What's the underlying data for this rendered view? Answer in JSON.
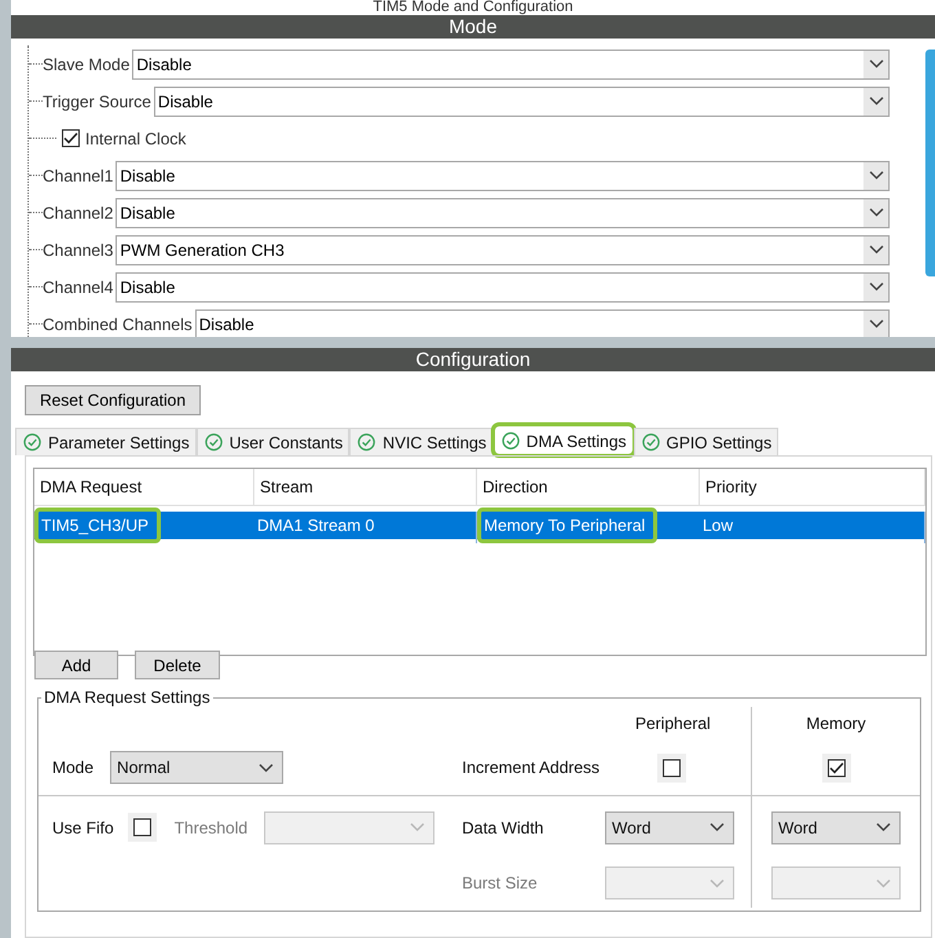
{
  "window": {
    "title": "TIM5 Mode and Configuration"
  },
  "mode": {
    "title": "Mode",
    "items": [
      {
        "kind": "select",
        "label": "Slave Mode",
        "value": "Disable"
      },
      {
        "kind": "select",
        "label": "Trigger Source",
        "value": "Disable"
      },
      {
        "kind": "checkbox",
        "label": "Internal Clock",
        "checked": true
      },
      {
        "kind": "select",
        "label": "Channel1",
        "value": "Disable"
      },
      {
        "kind": "select",
        "label": "Channel2",
        "value": "Disable"
      },
      {
        "kind": "select",
        "label": "Channel3",
        "value": "PWM Generation CH3"
      },
      {
        "kind": "select",
        "label": "Channel4",
        "value": "Disable"
      },
      {
        "kind": "select",
        "label": "Combined Channels",
        "value": "Disable"
      }
    ]
  },
  "configuration": {
    "title": "Configuration",
    "reset_button": "Reset Configuration",
    "tabs": [
      {
        "label": "Parameter Settings",
        "selected": false,
        "highlighted": false
      },
      {
        "label": "User Constants",
        "selected": false,
        "highlighted": false
      },
      {
        "label": "NVIC Settings",
        "selected": false,
        "highlighted": false
      },
      {
        "label": "DMA Settings",
        "selected": true,
        "highlighted": true
      },
      {
        "label": "GPIO Settings",
        "selected": false,
        "highlighted": false
      }
    ],
    "table": {
      "columns": [
        "DMA Request",
        "Stream",
        "Direction",
        "Priority"
      ],
      "rows": [
        {
          "selected": true,
          "cells": [
            {
              "text": "TIM5_CH3/UP",
              "highlighted": true
            },
            {
              "text": "DMA1 Stream 0",
              "highlighted": false
            },
            {
              "text": "Memory To Peripheral",
              "highlighted": true
            },
            {
              "text": "Low",
              "highlighted": false
            }
          ]
        }
      ]
    },
    "buttons": [
      "Add",
      "Delete"
    ],
    "settings": {
      "title": "DMA Request Settings",
      "peripheral_heading": "Peripheral",
      "memory_heading": "Memory",
      "mode": {
        "label": "Mode",
        "value": "Normal"
      },
      "increment_address": {
        "label": "Increment Address",
        "peripheral_checked": false,
        "memory_checked": true
      },
      "use_fifo": {
        "label": "Use Fifo",
        "checked": false
      },
      "threshold": {
        "label": "Threshold",
        "disabled": true
      },
      "data_width": {
        "label": "Data Width",
        "peripheral": "Word",
        "memory": "Word"
      },
      "burst_size": {
        "label": "Burst Size",
        "disabled": true
      }
    }
  }
}
